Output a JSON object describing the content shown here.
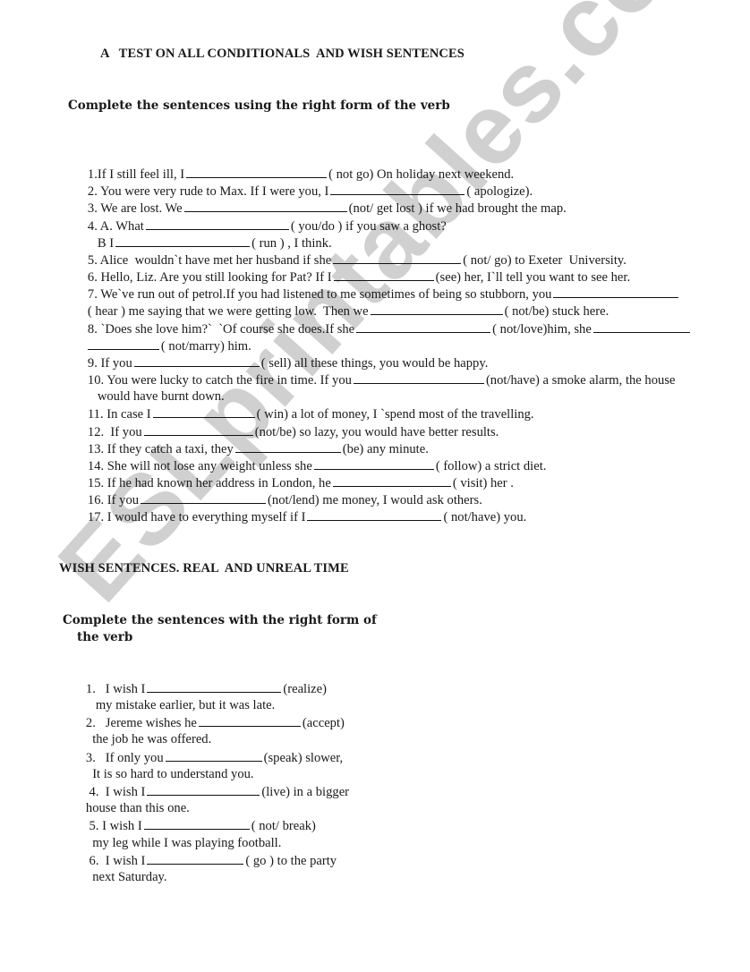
{
  "watermark": "ESLprintables.com",
  "section1": {
    "title": "A   TEST ON ALL CONDITIONALS  AND WISH SENTENCES",
    "instruction": "Complete the sentences using the right form of the verb",
    "items": [
      {
        "a": "1.If I still feel ill, I",
        "b": "( not go) On holiday next weekend."
      },
      {
        "a": "2. You were very rude to Max. If I were you, I",
        "b": "( apologize)."
      },
      {
        "a": "3. We are lost. We",
        "b": "(not/ get lost ) if we had brought the map."
      },
      {
        "a": "4. A. What",
        "b": "( you/do ) if you saw a ghost?"
      },
      {
        "a": "   B I",
        "b": "( run ) , I think."
      },
      {
        "a": "5. Alice  wouldn`t have met her husband if she",
        "b": "( not/ go) to Exeter  University."
      },
      {
        "a": "6. Hello, Liz. Are you still looking for Pat? If I",
        "b": "(see) her, I`ll tell you want to see her."
      },
      {
        "a": "7. We`ve run out of petrol.If you had listened to me sometimes of being so stubborn, you",
        "b": ""
      },
      {
        "a": "( hear ) me saying that we were getting low.  Then we",
        "b": "( not/be) stuck here."
      },
      {
        "a": "8. `Does she love him?`  `Of course she does.If she",
        "b": "( not/love)him, she"
      },
      {
        "a": "",
        "b": "( not/marry) him."
      },
      {
        "a": "9. If you",
        "b": "( sell) all these things, you would be happy."
      },
      {
        "a": "10. You were lucky to catch the fire in time. If you",
        "b": "(not/have) a smoke alarm, the house"
      },
      {
        "a": "   would have burnt down.",
        "b": ""
      },
      {
        "a": "11. In case I",
        "b": "( win) a lot of money, I `spend most of the travelling."
      },
      {
        "a": "12.  If you",
        "b": "(not/be) so lazy, you would have better results."
      },
      {
        "a": "13. If they catch a taxi, they",
        "b": "(be) any minute."
      },
      {
        "a": "14. She will not lose any weight unless she",
        "b": "( follow) a strict diet."
      },
      {
        "a": "15. If he had known her address in London, he",
        "b": "( visit) her ."
      },
      {
        "a": "16. If you",
        "b": "(not/lend) me money, I would ask others."
      },
      {
        "a": "17. I would have to everything myself if I",
        "b": "( not/have) you."
      }
    ]
  },
  "section2": {
    "title": "WISH SENTENCES. REAL  AND UNREAL TIME",
    "instruction_line1": "Complete the sentences with the right form of",
    "instruction_line2": "the verb",
    "items": [
      {
        "a": "1.   I wish I",
        "b": "(realize)"
      },
      {
        "a": "   my mistake earlier, but it was late.",
        "b": ""
      },
      {
        "a": "2.   Jereme wishes he",
        "b": "(accept)"
      },
      {
        "a": "  the job he was offered.",
        "b": ""
      },
      {
        "a": "3.   If only you",
        "b": "(speak) slower,"
      },
      {
        "a": "  It is so hard to understand you.",
        "b": ""
      },
      {
        "a": " 4.  I wish I",
        "b": "(live) in a bigger"
      },
      {
        "a": "house than this one.",
        "b": ""
      },
      {
        "a": " 5. I wish I",
        "b": "( not/ break)"
      },
      {
        "a": "  my leg while I was playing football.",
        "b": ""
      },
      {
        "a": " 6.  I wish I",
        "b": "( go ) to the party"
      },
      {
        "a": "  next Saturday.",
        "b": ""
      }
    ]
  }
}
